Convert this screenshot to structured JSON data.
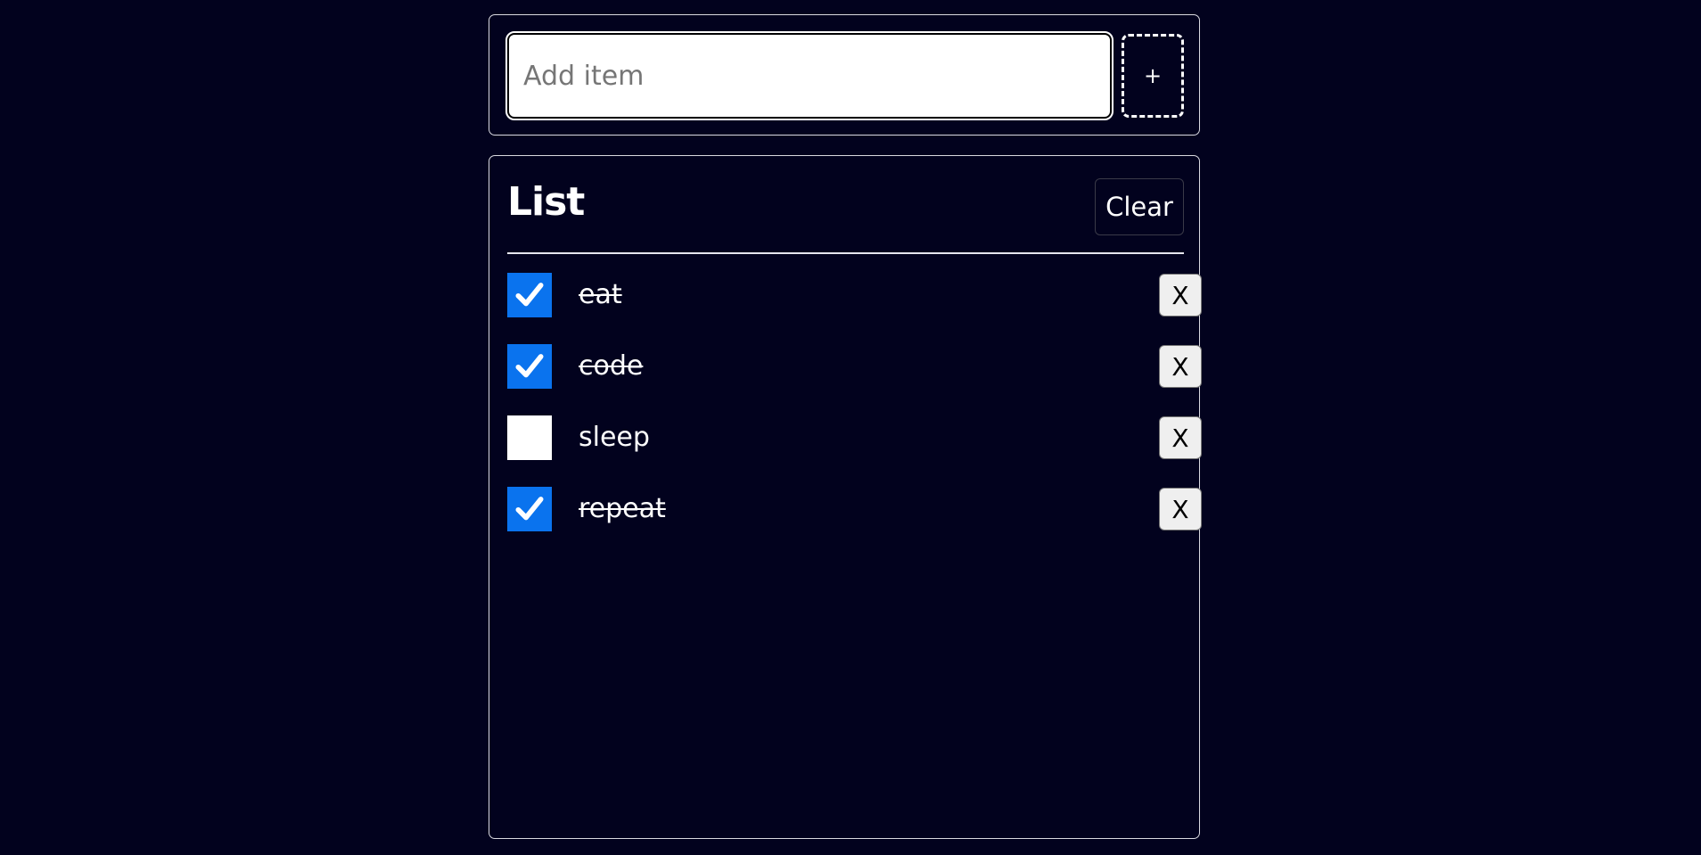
{
  "add_form": {
    "input_value": "",
    "input_placeholder": "Add item",
    "add_button_label": "+"
  },
  "list": {
    "title": "List",
    "clear_label": "Clear",
    "items": [
      {
        "label": "eat",
        "checked": true,
        "delete_label": "X"
      },
      {
        "label": "code",
        "checked": true,
        "delete_label": "X"
      },
      {
        "label": "sleep",
        "checked": false,
        "delete_label": "X"
      },
      {
        "label": "repeat",
        "checked": true,
        "delete_label": "X"
      }
    ]
  },
  "colors": {
    "background": "#02021e",
    "checkbox_checked": "#0a73ee",
    "panel_border": "#d9d9e0"
  },
  "icons": {
    "checkbox_mark": "check-icon"
  }
}
